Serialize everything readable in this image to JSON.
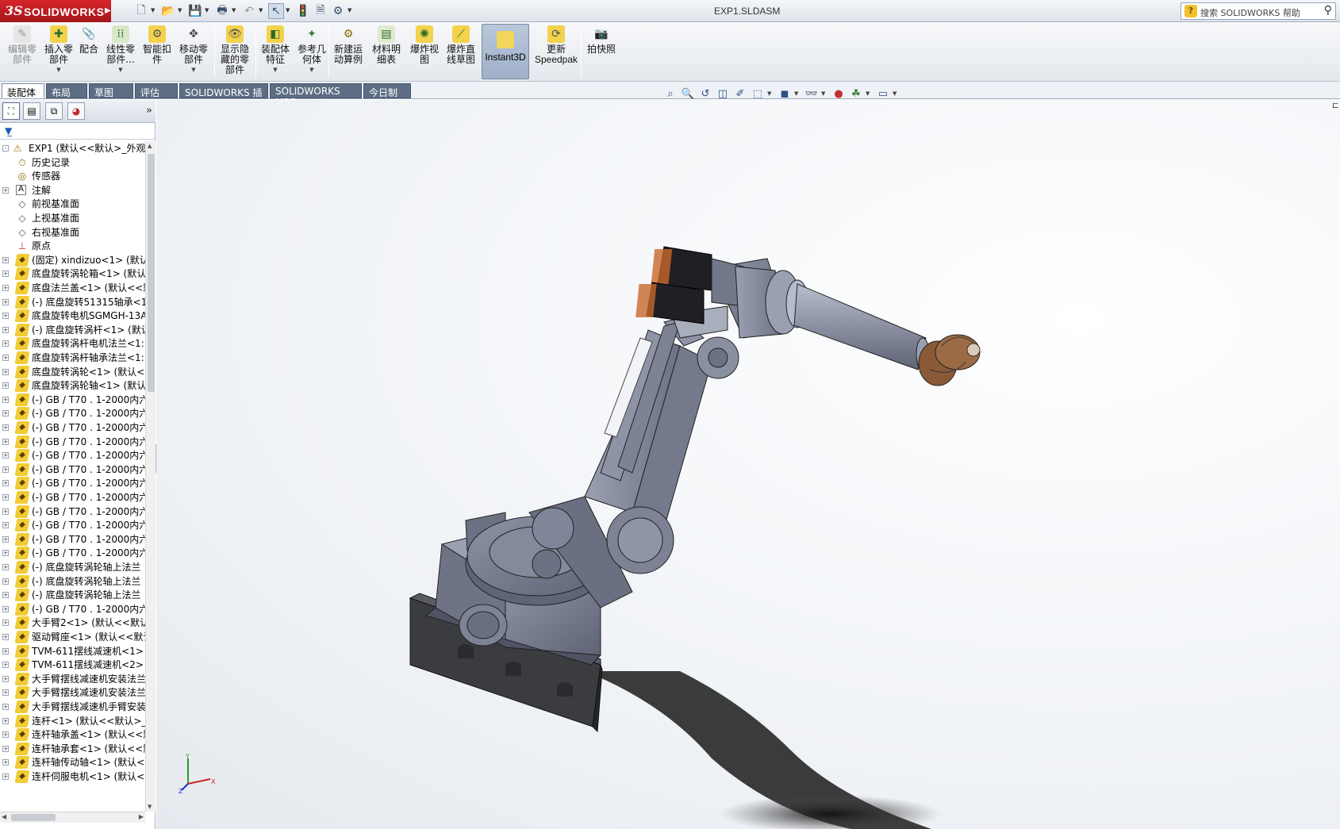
{
  "app": {
    "brand": "SOLIDWORKS",
    "document_title": "EXP1.SLDASM",
    "help_search_placeholder": "搜索 SOLIDWORKS 帮助"
  },
  "quick_access": [
    "new-icon",
    "open-icon",
    "save-icon",
    "print-icon",
    "undo-icon",
    "select-icon",
    "rebuild-icon",
    "file-properties-icon",
    "options-icon"
  ],
  "ribbon": {
    "commands": [
      {
        "id": "edit-part",
        "label1": "编辑零",
        "label2": "部件",
        "enabled": false,
        "icon": "edit-component-icon"
      },
      {
        "id": "insert-part",
        "label1": "插入零",
        "label2": "部件",
        "enabled": true,
        "icon": "insert-component-icon"
      },
      {
        "id": "mate",
        "label1": "配合",
        "label2": "",
        "enabled": true,
        "icon": "mate-icon"
      },
      {
        "id": "linear-pattern",
        "label1": "线性零",
        "label2": "部件...",
        "enabled": true,
        "icon": "linear-pattern-icon"
      },
      {
        "id": "smart-fasteners",
        "label1": "智能扣",
        "label2": "件",
        "enabled": true,
        "icon": "smart-fastener-icon"
      },
      {
        "id": "move-component",
        "label1": "移动零",
        "label2": "部件",
        "enabled": true,
        "icon": "move-component-icon"
      },
      {
        "id": "show-hidden",
        "label1": "显示隐",
        "label2": "藏的零",
        "label3": "部件",
        "enabled": true,
        "icon": "show-hidden-icon"
      },
      {
        "id": "assembly-features",
        "label1": "装配体",
        "label2": "特征",
        "enabled": true,
        "icon": "assembly-feature-icon"
      },
      {
        "id": "reference-geometry",
        "label1": "参考几",
        "label2": "何体",
        "enabled": true,
        "icon": "reference-geometry-icon"
      },
      {
        "id": "new-motion-study",
        "label1": "新建运",
        "label2": "动算例",
        "enabled": true,
        "icon": "motion-study-icon"
      },
      {
        "id": "bom",
        "label1": "材料明",
        "label2": "细表",
        "enabled": true,
        "icon": "bom-icon"
      },
      {
        "id": "exploded-view",
        "label1": "爆炸视",
        "label2": "图",
        "enabled": true,
        "icon": "exploded-view-icon"
      },
      {
        "id": "explode-line-sketch",
        "label1": "爆炸直",
        "label2": "线草图",
        "enabled": true,
        "icon": "explode-line-icon"
      },
      {
        "id": "instant3d",
        "label1": "Instant3D",
        "label2": "",
        "enabled": true,
        "icon": "instant3d-icon"
      },
      {
        "id": "update-speedpak",
        "label1": "更新",
        "label2": "Speedpak",
        "enabled": true,
        "icon": "speedpak-icon"
      },
      {
        "id": "snapshot",
        "label1": "拍快照",
        "label2": "",
        "enabled": true,
        "icon": "snapshot-icon"
      }
    ]
  },
  "tabs": [
    {
      "label": "装配体",
      "active": true
    },
    {
      "label": "布局",
      "active": false
    },
    {
      "label": "草图",
      "active": false
    },
    {
      "label": "评估",
      "active": false
    },
    {
      "label": "SOLIDWORKS 插件",
      "active": false
    },
    {
      "label": "SOLIDWORKS MBD",
      "active": false
    },
    {
      "label": "今日制造",
      "active": false
    }
  ],
  "hud_toolbar": [
    "zoom-to-fit-icon",
    "zoom-area-icon",
    "previous-view-icon",
    "section-view-icon",
    "dynamic-annotation-icon",
    "view-orientation-icon",
    "display-style-icon",
    "hide-show-icon",
    "edit-appearance-icon",
    "apply-scene-icon",
    "view-settings-icon"
  ],
  "feature_manager": {
    "tabs": [
      "feature-manager-icon",
      "property-manager-icon",
      "configuration-manager-icon",
      "display-manager-icon"
    ],
    "tree": [
      {
        "label": "EXP1  (默认<<默认>_外观",
        "type": "root",
        "expand": "-"
      },
      {
        "label": "历史记录",
        "type": "history"
      },
      {
        "label": "传感器",
        "type": "sensor"
      },
      {
        "label": "注解",
        "type": "annotation",
        "expand": "+"
      },
      {
        "label": "前视基准面",
        "type": "plane"
      },
      {
        "label": "上视基准面",
        "type": "plane"
      },
      {
        "label": "右视基准面",
        "type": "plane"
      },
      {
        "label": "原点",
        "type": "origin"
      },
      {
        "label": "(固定) xindizuo<1> (默认",
        "type": "part",
        "expand": "+"
      },
      {
        "label": "底盘旋转涡轮箱<1> (默认",
        "type": "part",
        "expand": "+"
      },
      {
        "label": "底盘法兰盖<1> (默认<<默",
        "type": "part",
        "expand": "+"
      },
      {
        "label": "(-) 底盘旋转51315轴承<1",
        "type": "part",
        "expand": "+"
      },
      {
        "label": "底盘旋转电机SGMGH-13A",
        "type": "part",
        "expand": "+"
      },
      {
        "label": "(-) 底盘旋转涡杆<1> (默认",
        "type": "part",
        "expand": "+"
      },
      {
        "label": "底盘旋转涡杆电机法兰<1:",
        "type": "part",
        "expand": "+"
      },
      {
        "label": "底盘旋转涡杆轴承法兰<1:",
        "type": "part",
        "expand": "+"
      },
      {
        "label": "底盘旋转涡轮<1> (默认<",
        "type": "part",
        "expand": "+"
      },
      {
        "label": "底盘旋转涡轮轴<1> (默认",
        "type": "part",
        "expand": "+"
      },
      {
        "label": "(-) GB / T70 . 1-2000内六",
        "type": "part",
        "expand": "+"
      },
      {
        "label": "(-) GB / T70 . 1-2000内六",
        "type": "part",
        "expand": "+"
      },
      {
        "label": "(-) GB / T70 . 1-2000内六",
        "type": "part",
        "expand": "+"
      },
      {
        "label": "(-) GB / T70 . 1-2000内六",
        "type": "part",
        "expand": "+"
      },
      {
        "label": "(-) GB / T70 . 1-2000内六",
        "type": "part",
        "expand": "+"
      },
      {
        "label": "(-) GB / T70 . 1-2000内六",
        "type": "part",
        "expand": "+"
      },
      {
        "label": "(-) GB / T70 . 1-2000内六",
        "type": "part",
        "expand": "+"
      },
      {
        "label": "(-) GB / T70 . 1-2000内六",
        "type": "part",
        "expand": "+"
      },
      {
        "label": "(-) GB / T70 . 1-2000内六",
        "type": "part",
        "expand": "+"
      },
      {
        "label": "(-) GB / T70 . 1-2000内六",
        "type": "part",
        "expand": "+"
      },
      {
        "label": "(-) GB / T70 . 1-2000内六",
        "type": "part",
        "expand": "+"
      },
      {
        "label": "(-) GB / T70 . 1-2000内六",
        "type": "part",
        "expand": "+"
      },
      {
        "label": "(-) 底盘旋转涡轮轴上法兰",
        "type": "part",
        "expand": "+"
      },
      {
        "label": "(-) 底盘旋转涡轮轴上法兰",
        "type": "part",
        "expand": "+"
      },
      {
        "label": "(-) 底盘旋转涡轮轴上法兰",
        "type": "part",
        "expand": "+"
      },
      {
        "label": "(-) GB / T70 . 1-2000内六",
        "type": "part",
        "expand": "+"
      },
      {
        "label": "大手臂2<1> (默认<<默认",
        "type": "part",
        "expand": "+"
      },
      {
        "label": "驱动臂座<1> (默认<<默认",
        "type": "part",
        "expand": "+"
      },
      {
        "label": "TVM-611摆线减速机<1>",
        "type": "part",
        "expand": "+"
      },
      {
        "label": "TVM-611摆线减速机<2>",
        "type": "part",
        "expand": "+"
      },
      {
        "label": "大手臂摆线减速机安装法兰",
        "type": "part",
        "expand": "+"
      },
      {
        "label": "大手臂摆线减速机安装法兰",
        "type": "part",
        "expand": "+"
      },
      {
        "label": "大手臂摆线减速机手臂安装",
        "type": "part",
        "expand": "+"
      },
      {
        "label": "连杆<1> (默认<<默认>_",
        "type": "part",
        "expand": "+"
      },
      {
        "label": "连杆轴承盖<1> (默认<<默",
        "type": "part",
        "expand": "+"
      },
      {
        "label": "连杆轴承套<1> (默认<<默",
        "type": "part",
        "expand": "+"
      },
      {
        "label": "连杆轴传动轴<1> (默认<",
        "type": "part",
        "expand": "+"
      },
      {
        "label": "连杆伺服电机<1> (默认<",
        "type": "part",
        "expand": "+"
      }
    ]
  },
  "triad_axes": [
    "Y",
    "X",
    "Z"
  ],
  "colors": {
    "brand_red": "#c81e24",
    "model_body": "#7c8294",
    "model_shadow": "#1a1a1a",
    "motor_orange": "#c8682a"
  }
}
